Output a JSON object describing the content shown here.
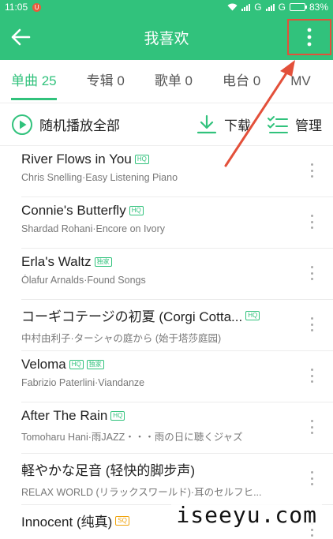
{
  "status_bar": {
    "time": "11:05",
    "notification_badge": "U",
    "network_1": "G",
    "network_2": "G",
    "battery": "83%",
    "battery_level": 0.83
  },
  "app_bar": {
    "title": "我喜欢",
    "back_icon": "back-arrow-icon",
    "more_icon": "more-vertical-icon"
  },
  "tabs": [
    {
      "label": "单曲 25",
      "active": true
    },
    {
      "label": "专辑 0",
      "active": false
    },
    {
      "label": "歌单 0",
      "active": false
    },
    {
      "label": "电台 0",
      "active": false
    },
    {
      "label": "MV",
      "active": false
    }
  ],
  "actions": {
    "play_all": "随机播放全部",
    "download": "下载",
    "manage": "管理"
  },
  "songs": [
    {
      "title": "River Flows in You",
      "subtitle": "Chris Snelling·Easy Listening Piano",
      "badges": [
        "HQ"
      ]
    },
    {
      "title": "Connie's Butterfly",
      "subtitle": "Shardad Rohani·Encore on Ivory",
      "badges": [
        "HQ"
      ]
    },
    {
      "title": "Erla's Waltz",
      "subtitle": "Ólafur Arnalds·Found Songs",
      "badges": [
        "独家"
      ]
    },
    {
      "title": "コーギコテージの初夏 (Corgi Cotta...",
      "subtitle": "中村由利子·ターシャの庭から (始于塔莎庭园)",
      "badges": [
        "HQ"
      ]
    },
    {
      "title": "Veloma",
      "subtitle": "Fabrizio Paterlini·Viandanze",
      "badges": [
        "HQ",
        "独家"
      ]
    },
    {
      "title": "After The Rain",
      "subtitle": "Tomoharu Hani·雨JAZZ・・・雨の日に聴くジャズ",
      "badges": [
        "HQ"
      ]
    },
    {
      "title": "軽やかな足音 (轻快的脚步声)",
      "subtitle": "RELAX WORLD (リラックスワールド)·耳のセルフヒ...",
      "badges": []
    },
    {
      "title": "Innocent (纯真)",
      "subtitle": "",
      "badges": [
        "SQ"
      ]
    }
  ],
  "watermark": "iseeyu.com",
  "colors": {
    "accent": "#31c27c",
    "annotation": "#e3503a"
  }
}
